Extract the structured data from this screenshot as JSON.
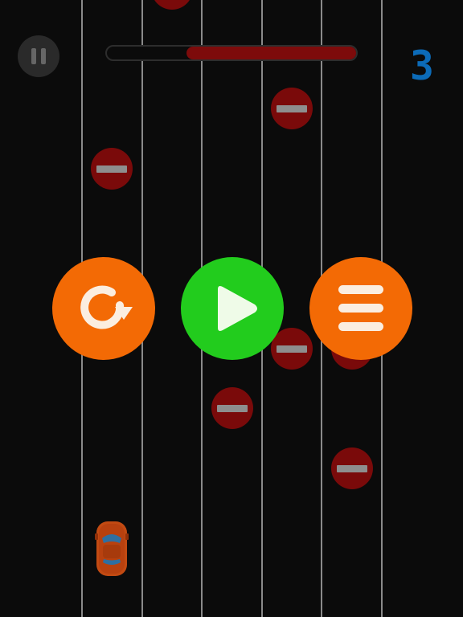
{
  "hud": {
    "score": "3",
    "progress_fraction": 0.68,
    "progress_color": "#7d0b0b",
    "score_color": "#0c6bb8"
  },
  "buttons": {
    "restart": {
      "icon": "restart-icon",
      "color": "#f36a05"
    },
    "play": {
      "icon": "play-icon",
      "color": "#22cc1d"
    },
    "menu": {
      "icon": "hamburger-menu-icon",
      "color": "#f36a05"
    }
  },
  "pause_button": {
    "icon": "pause-icon"
  },
  "obstacle": {
    "icon": "no-entry-sign",
    "color": "#7a0a0a"
  },
  "player": {
    "icon": "orange-car-icon",
    "color": "#c24a12"
  }
}
